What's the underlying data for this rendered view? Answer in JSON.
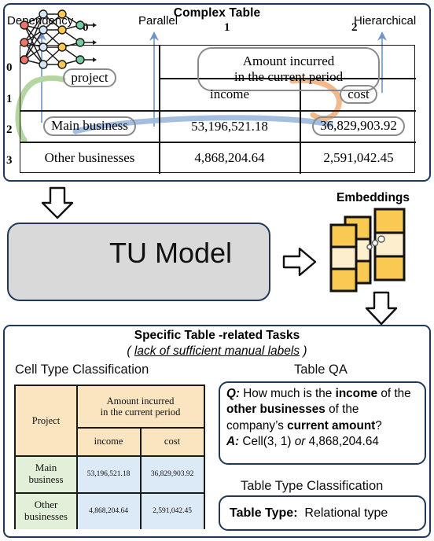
{
  "theme": {
    "panel_border": "#20385c",
    "arrow_blue": "#6f92c9",
    "curve_green": "#b5d6a0",
    "curve_orange": "#f3b98a",
    "curve_blue": "#9fbbdd",
    "chip_grey": "#8a8a8a",
    "model_fill": "#d9d9d9",
    "embed_gold": "#fac951",
    "embed_cream": "#fdeece",
    "header_peach": "#fbe5c0",
    "rowhead_green": "#e2efd9",
    "data_blue": "#dce9f6"
  },
  "complex_table": {
    "title": "Complex Table",
    "annotations": [
      {
        "id": "dependency",
        "label": "Dependency"
      },
      {
        "id": "parallel",
        "label": "Parallel"
      },
      {
        "id": "hierarchical",
        "label": "Hierarchical"
      }
    ],
    "column_indices": [
      "0",
      "1",
      "2"
    ],
    "row_indices": [
      "0",
      "1",
      "2",
      "3"
    ],
    "cells": {
      "project": "project",
      "amount_line1": "Amount incurred",
      "amount_line2": "in the current period",
      "income": "income",
      "cost": "cost",
      "main_business": "Main business",
      "main_income": "53,196,521.18",
      "main_cost": "36,829,903.92",
      "other_business": "Other businesses",
      "other_income": "4,868,204.64",
      "other_cost": "2,591,042.45"
    }
  },
  "model": {
    "label": "TU Model",
    "embeddings_label": "Embeddings"
  },
  "tasks": {
    "title": "Specific Table -related Tasks",
    "subtitle_open": "( ",
    "subtitle_underlined": "lack of sufficient manual labels",
    "subtitle_close": " )",
    "cell_type_label": "Cell Type Classification",
    "table_qa_label": "Table QA",
    "table_type_label": "Table Type Classification",
    "mini_table": {
      "project": "Project",
      "amount_line1": "Amount incurred",
      "amount_line2": "in the current period",
      "income": "income",
      "cost": "cost",
      "main_line1": "Main",
      "main_line2": "business",
      "other_line1": "Other",
      "other_line2": "businesses",
      "main_income": "53,196,521.18",
      "main_cost": "36,829,903.92",
      "other_income": "4,868,204.64",
      "other_cost": "2,591,042.45"
    },
    "qa": {
      "q_prefix": "Q:",
      "q_part1": " How much is the ",
      "q_bold1": "income",
      "q_part2": " of the ",
      "q_bold2": "other businesses",
      "q_part3": " of the company’s ",
      "q_bold3": "current amount",
      "q_part4": "?",
      "a_prefix": "A:",
      "a_part1": " Cell(3, 1) ",
      "a_italic": "or",
      "a_part2": " 4,868,204.64"
    },
    "table_type": {
      "key": "Table Type:",
      "value": "Relational type"
    }
  }
}
